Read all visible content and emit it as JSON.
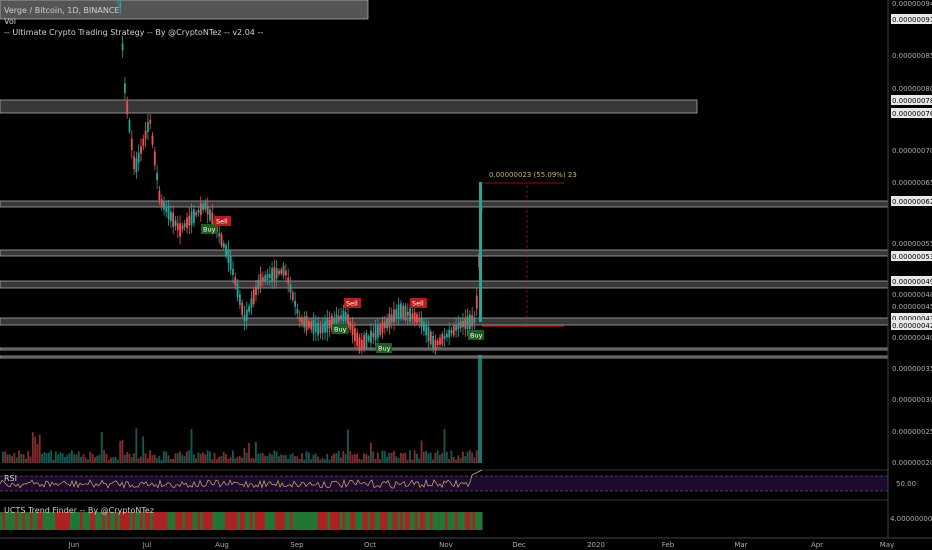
{
  "header": {
    "symbol_line": "Verge / Bitcoin, 1D, BINANCE",
    "volume_label": "Vol",
    "strategy_label": "-- Ultimate Crypto Trading Strategy -- By @CryptoNTez -- v2.04 --"
  },
  "price_axis": {
    "ticks": [
      "0.00000094",
      "0.00000091",
      "0.00000085",
      "0.00000080",
      "0.00000078",
      "0.00000076",
      "0.00000070",
      "0.00000065",
      "0.00000062",
      "0.00000055",
      "0.00000053",
      "0.00000049",
      "0.00000048",
      "0.00000045",
      "0.00000043",
      "0.00000042",
      "0.00000040",
      "0.00000035",
      "0.00000030",
      "0.00000025",
      "0.00000020"
    ],
    "highlighted": [
      "0.00000091",
      "0.00000078",
      "0.00000076",
      "0.00000062",
      "0.00000053",
      "0.00000049",
      "0.00000043",
      "0.00000042"
    ]
  },
  "measure": {
    "label": "0.00000023 (55.09%) 23"
  },
  "signals": [
    {
      "text": "Buy",
      "type": "buy"
    },
    {
      "text": "Sell",
      "type": "sell"
    },
    {
      "text": "Buy",
      "type": "buy"
    },
    {
      "text": "Sell",
      "type": "sell"
    },
    {
      "text": "Buy",
      "type": "buy"
    },
    {
      "text": "Sell",
      "type": "sell"
    },
    {
      "text": "Buy",
      "type": "buy"
    }
  ],
  "rsi": {
    "label": "RSI",
    "level": "50.00"
  },
  "trend_finder": {
    "label": "UCTS Trend Finder -- By @CryptoNTez",
    "value": "4.00000000"
  },
  "time_axis": [
    "Jun",
    "Jul",
    "Aug",
    "Sep",
    "Oct",
    "Nov",
    "Dec",
    "2020",
    "Feb",
    "Mar",
    "Apr",
    "May"
  ],
  "colors": {
    "up": "#26a69a",
    "down": "#ef5350",
    "zone": "#a0a0a0",
    "rsi_bg": "#1e0a2e",
    "rsi_line": "#c8b46e",
    "buy": "#1b5e20",
    "sell": "#b71c1c"
  }
}
